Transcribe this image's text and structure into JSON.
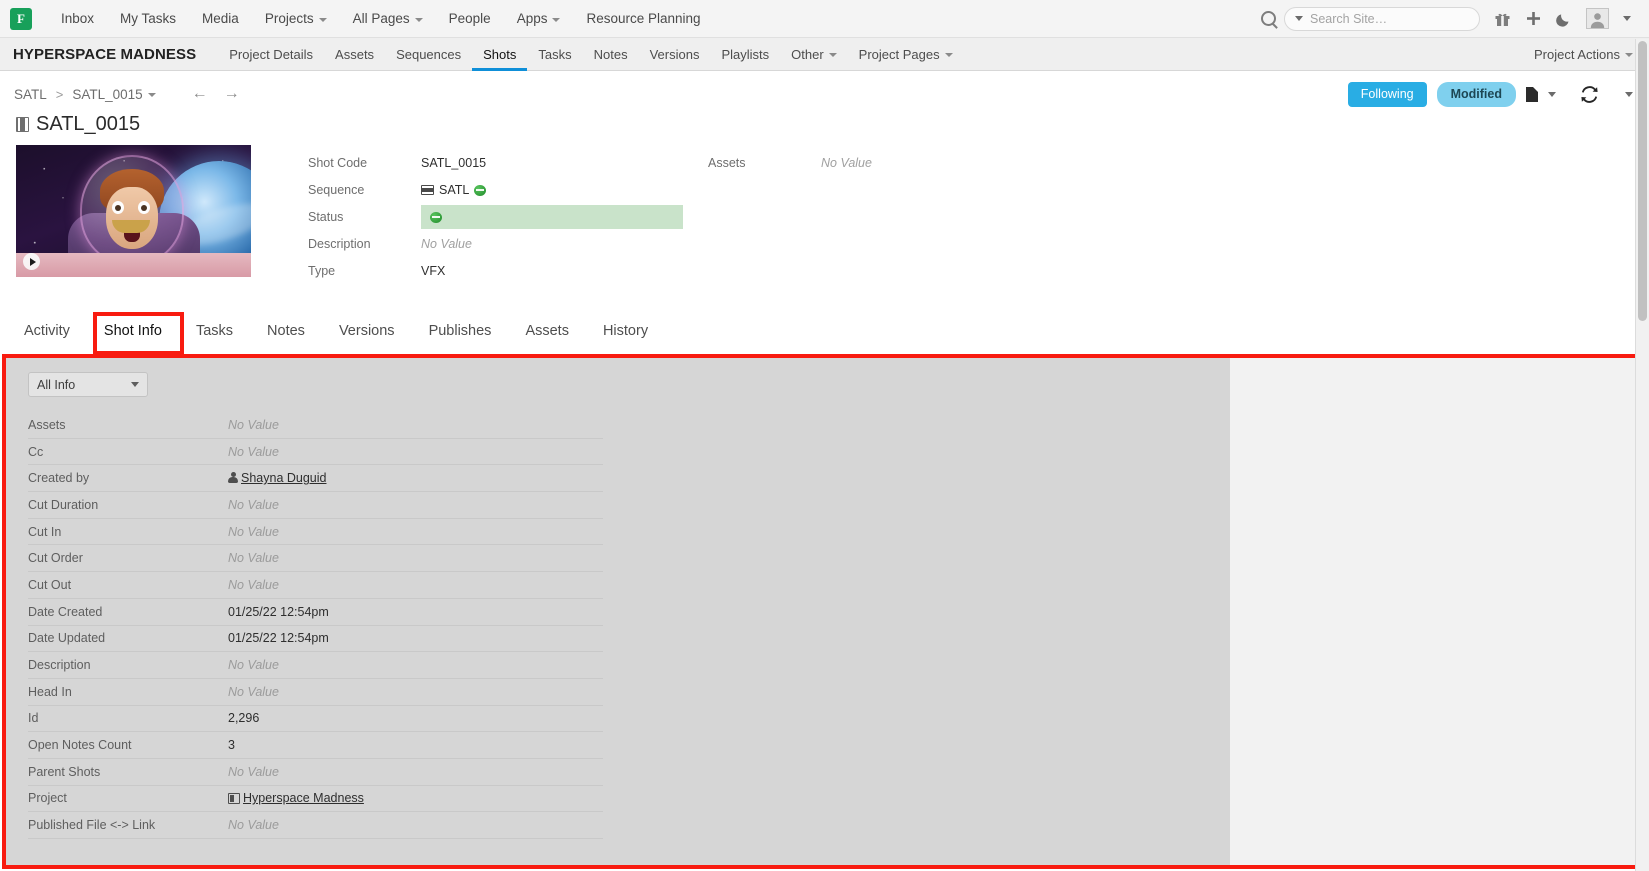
{
  "global_nav": {
    "logo_letter": "F",
    "items": [
      {
        "label": "Inbox",
        "caret": false
      },
      {
        "label": "My Tasks",
        "caret": false
      },
      {
        "label": "Media",
        "caret": false
      },
      {
        "label": "Projects",
        "caret": true
      },
      {
        "label": "All Pages",
        "caret": true
      },
      {
        "label": "People",
        "caret": false
      },
      {
        "label": "Apps",
        "caret": true
      },
      {
        "label": "Resource Planning",
        "caret": false
      }
    ],
    "search": {
      "placeholder": "Search Site…",
      "value": ""
    },
    "icons": [
      "search-icon",
      "gift-icon",
      "plus-icon",
      "moon-icon",
      "avatar",
      "chevron-down-icon"
    ]
  },
  "project_nav": {
    "project_title": "HYPERSPACE MADNESS",
    "items": [
      {
        "label": "Project Details",
        "caret": false,
        "active": false
      },
      {
        "label": "Assets",
        "caret": false,
        "active": false
      },
      {
        "label": "Sequences",
        "caret": false,
        "active": false
      },
      {
        "label": "Shots",
        "caret": false,
        "active": true
      },
      {
        "label": "Tasks",
        "caret": false,
        "active": false
      },
      {
        "label": "Notes",
        "caret": false,
        "active": false
      },
      {
        "label": "Versions",
        "caret": false,
        "active": false
      },
      {
        "label": "Playlists",
        "caret": false,
        "active": false
      },
      {
        "label": "Other",
        "caret": true,
        "active": false
      },
      {
        "label": "Project Pages",
        "caret": true,
        "active": false
      }
    ],
    "actions_label": "Project Actions"
  },
  "breadcrumb": {
    "root": "SATL",
    "separator": ">",
    "current": "SATL_0015",
    "back_arrow": "←",
    "forward_arrow": "→"
  },
  "page_actions": {
    "following_label": "Following",
    "modified_label": "Modified",
    "following_color": "#29ade4",
    "modified_color": "#7fd0ee"
  },
  "shot": {
    "title": "SATL_0015",
    "fields_left": [
      {
        "label": "Shot Code",
        "value": "SATL_0015",
        "type": "text"
      },
      {
        "label": "Sequence",
        "value": "SATL",
        "type": "sequence"
      },
      {
        "label": "Status",
        "value": "",
        "type": "status"
      },
      {
        "label": "Description",
        "value": "No Value",
        "type": "empty"
      },
      {
        "label": "Type",
        "value": "VFX",
        "type": "text"
      }
    ],
    "fields_right": [
      {
        "label": "Assets",
        "value": "No Value",
        "type": "empty"
      }
    ],
    "status_color": "#c9e3ca"
  },
  "tabs": [
    {
      "label": "Activity",
      "active": false
    },
    {
      "label": "Shot Info",
      "active": true
    },
    {
      "label": "Tasks",
      "active": false
    },
    {
      "label": "Notes",
      "active": false
    },
    {
      "label": "Versions",
      "active": false
    },
    {
      "label": "Publishes",
      "active": false
    },
    {
      "label": "Assets",
      "active": false
    },
    {
      "label": "History",
      "active": false
    }
  ],
  "info_panel": {
    "filter_selected": "All Info",
    "filter_options": [
      "All Info"
    ],
    "rows": [
      {
        "label": "Assets",
        "value": "No Value",
        "type": "empty"
      },
      {
        "label": "Cc",
        "value": "No Value",
        "type": "empty"
      },
      {
        "label": "Created by",
        "value": "Shayna Duguid",
        "type": "person-link"
      },
      {
        "label": "Cut Duration",
        "value": "No Value",
        "type": "empty"
      },
      {
        "label": "Cut In",
        "value": "No Value",
        "type": "empty"
      },
      {
        "label": "Cut Order",
        "value": "No Value",
        "type": "empty"
      },
      {
        "label": "Cut Out",
        "value": "No Value",
        "type": "empty"
      },
      {
        "label": "Date Created",
        "value": "01/25/22 12:54pm",
        "type": "text"
      },
      {
        "label": "Date Updated",
        "value": "01/25/22 12:54pm",
        "type": "text"
      },
      {
        "label": "Description",
        "value": "No Value",
        "type": "empty"
      },
      {
        "label": "Head In",
        "value": "No Value",
        "type": "empty"
      },
      {
        "label": "Id",
        "value": "2,296",
        "type": "text"
      },
      {
        "label": "Open Notes Count",
        "value": "3",
        "type": "text"
      },
      {
        "label": "Parent Shots",
        "value": "No Value",
        "type": "empty"
      },
      {
        "label": "Project",
        "value": "Hyperspace Madness",
        "type": "project-link"
      },
      {
        "label": "Published File <-> Link",
        "value": "No Value",
        "type": "empty"
      }
    ]
  },
  "annotations": {
    "highlight_color": "#f81b10",
    "boxes": [
      "shot-info-tab",
      "info-panel-region"
    ]
  }
}
